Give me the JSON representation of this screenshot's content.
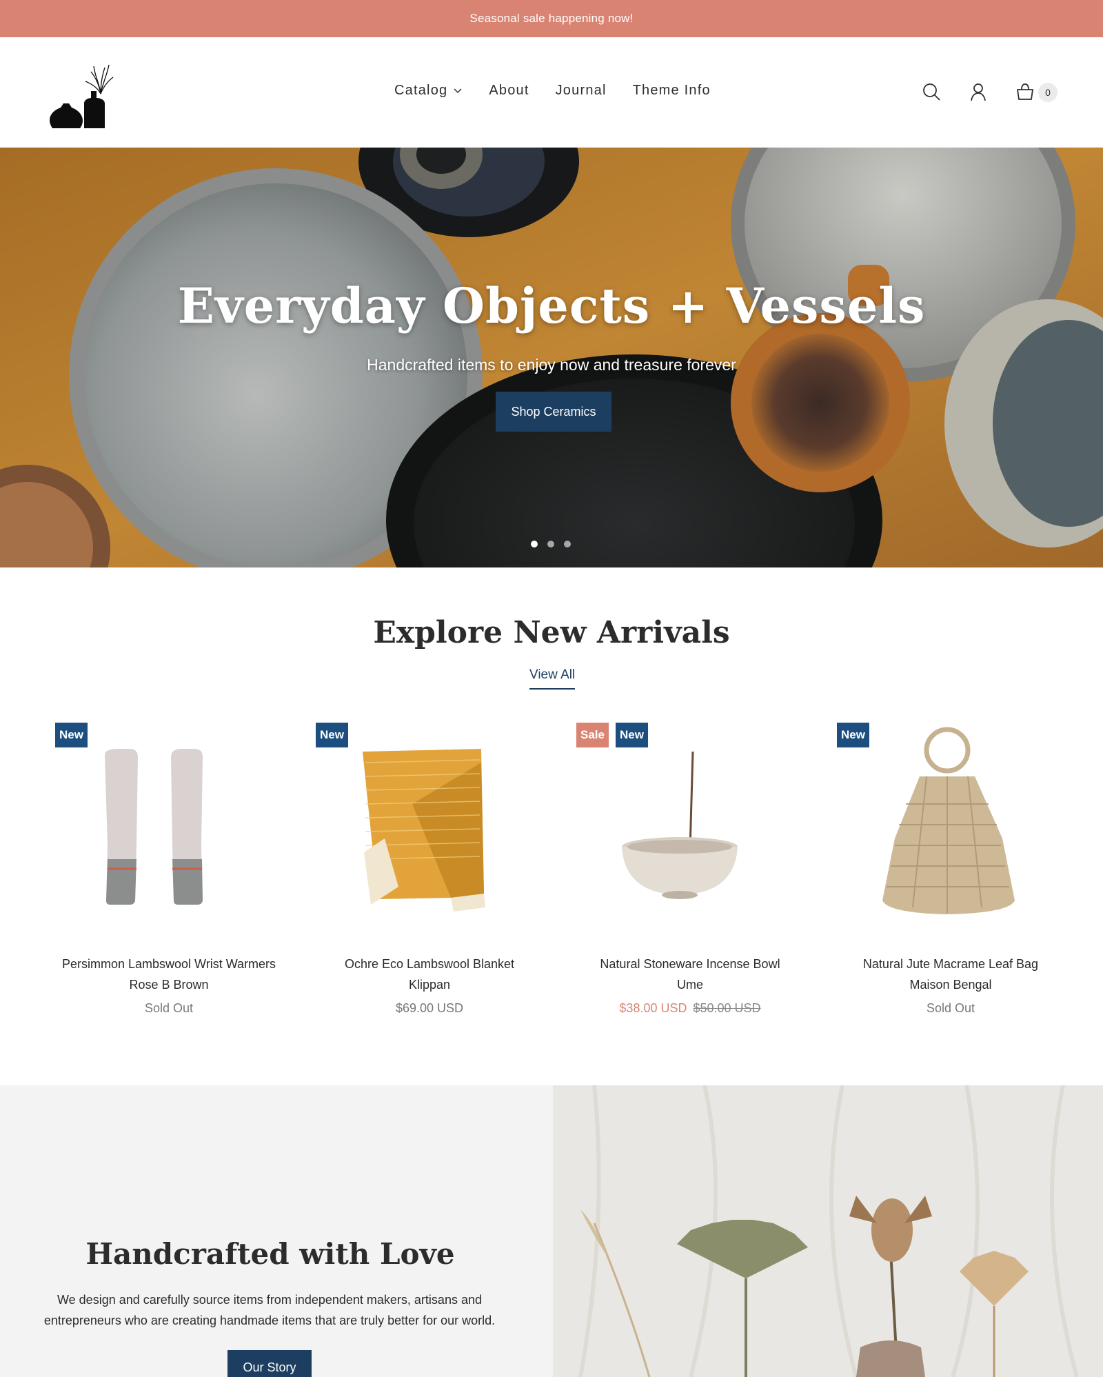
{
  "announcement": "Seasonal sale happening now!",
  "header": {
    "nav": [
      {
        "label": "Catalog",
        "has_dropdown": true
      },
      {
        "label": "About"
      },
      {
        "label": "Journal"
      },
      {
        "label": "Theme Info"
      }
    ],
    "icons": [
      "search-icon",
      "account-icon",
      "cart-icon"
    ],
    "cart_count": "0"
  },
  "hero": {
    "title": "Everyday Objects + Vessels",
    "subtitle": "Handcrafted items to enjoy now and treasure forever",
    "button": "Shop Ceramics",
    "slides": 3,
    "active_slide": 1
  },
  "arrivals": {
    "title": "Explore New Arrivals",
    "view_all": "View All",
    "products": [
      {
        "badges": [
          "New"
        ],
        "title": "Persimmon Lambswool Wrist Warmers",
        "vendor": "Rose B Brown",
        "price": "Sold Out"
      },
      {
        "badges": [
          "New"
        ],
        "title": "Ochre Eco Lambswool Blanket",
        "vendor": "Klippan",
        "price": "$69.00 USD"
      },
      {
        "badges": [
          "Sale",
          "New"
        ],
        "title": "Natural Stoneware Incense Bowl",
        "vendor": "Ume",
        "sale_price": "$38.00 USD",
        "compare_price": "$50.00 USD"
      },
      {
        "badges": [
          "New"
        ],
        "title": "Natural Jute Macrame Leaf Bag",
        "vendor": "Maison Bengal",
        "price": "Sold Out"
      }
    ]
  },
  "story": {
    "title": "Handcrafted with Love",
    "text": "We design and carefully source items from independent makers, artisans and entrepreneurs who are creating handmade items that are truly better for our world.",
    "button": "Our Story"
  },
  "colors": {
    "accent": "#d98473",
    "brand": "#1c3f61",
    "badge_new": "#1c4f80"
  }
}
